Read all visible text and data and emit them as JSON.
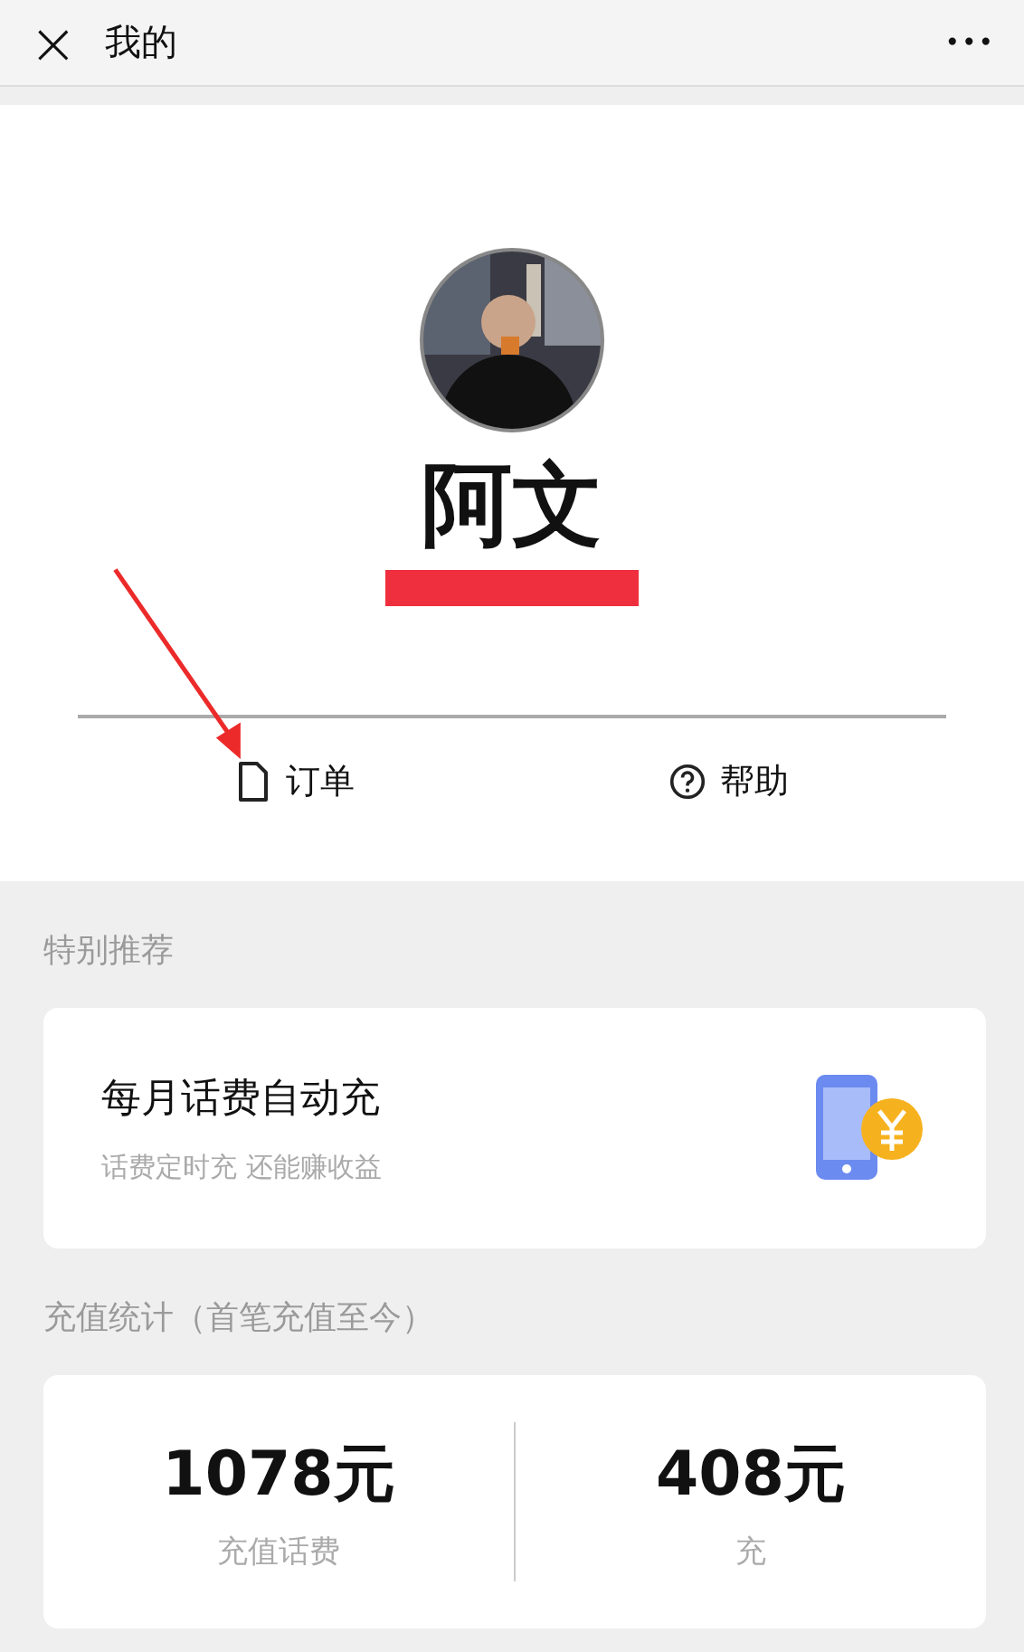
{
  "top_bar": {
    "close_icon": "×",
    "title": "我的",
    "more": "•••"
  },
  "profile": {
    "name": "阿文",
    "redacted": true,
    "actions": [
      {
        "kind": "orders",
        "label": "订单"
      },
      {
        "kind": "help",
        "label": "帮助"
      }
    ]
  },
  "recommend": {
    "heading": "特别推荐",
    "card": {
      "title": "每月话费自动充",
      "subtitle": "话费定时充 还能赚收益"
    }
  },
  "stats": {
    "heading": "充值统计（首笔充值至今）",
    "items": [
      {
        "value": "1078元",
        "label": "充值话费"
      },
      {
        "value": "408元",
        "label": "充"
      }
    ]
  }
}
